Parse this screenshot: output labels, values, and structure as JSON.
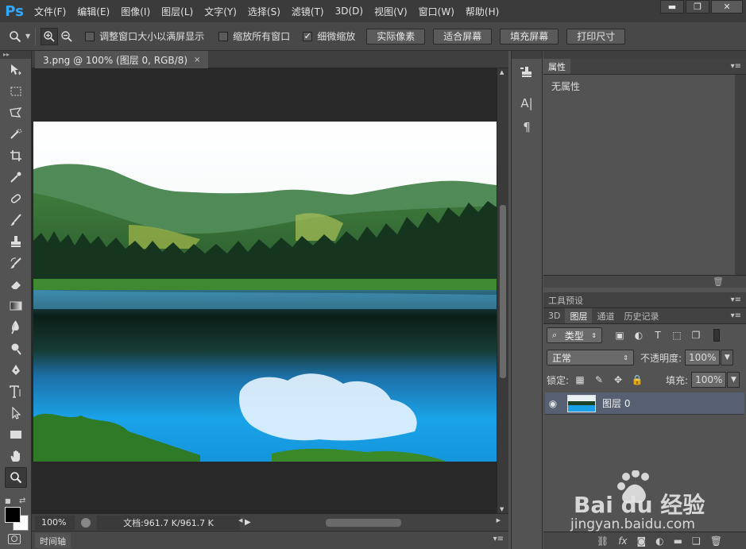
{
  "app": {
    "logo": "Ps"
  },
  "menu": [
    "文件(F)",
    "编辑(E)",
    "图像(I)",
    "图层(L)",
    "文字(Y)",
    "选择(S)",
    "滤镜(T)",
    "3D(D)",
    "视图(V)",
    "窗口(W)",
    "帮助(H)"
  ],
  "window_controls": {
    "minimize": "▬",
    "restore": "❐",
    "close": "✕"
  },
  "options": {
    "chk_resize": {
      "label": "调整窗口大小以满屏显示",
      "checked": false
    },
    "chk_zoom_all": {
      "label": "缩放所有窗口",
      "checked": false
    },
    "chk_scrubby": {
      "label": "细微缩放",
      "checked": true
    },
    "btn_actual": "实际像素",
    "btn_fit": "适合屏幕",
    "btn_fill": "填充屏幕",
    "btn_print": "打印尺寸"
  },
  "document": {
    "tab_title": "3.png @ 100% (图层 0, RGB/8)",
    "tab_close": "×",
    "zoom": "100%",
    "doc_size": "文档:961.7 K/961.7 K"
  },
  "timeline": {
    "label": "时间轴"
  },
  "properties": {
    "tab": "属性",
    "content": "无属性"
  },
  "presets": {
    "tab": "工具预设"
  },
  "layers_panel": {
    "tabs": [
      "3D",
      "图层",
      "通道",
      "历史记录"
    ],
    "active_tab": 1,
    "filter_kind": "类型",
    "blend_mode": "正常",
    "opacity_label": "不透明度:",
    "opacity": "100%",
    "lock_label": "锁定:",
    "fill_label": "填充:",
    "fill": "100%",
    "layers": [
      {
        "name": "图层 0",
        "visible": true
      }
    ]
  },
  "watermark": {
    "brand": "Bai du 经验",
    "url": "jingyan.baidu.com"
  },
  "colors": {
    "accent": "#31a8ff",
    "selected_layer": "#576072"
  }
}
